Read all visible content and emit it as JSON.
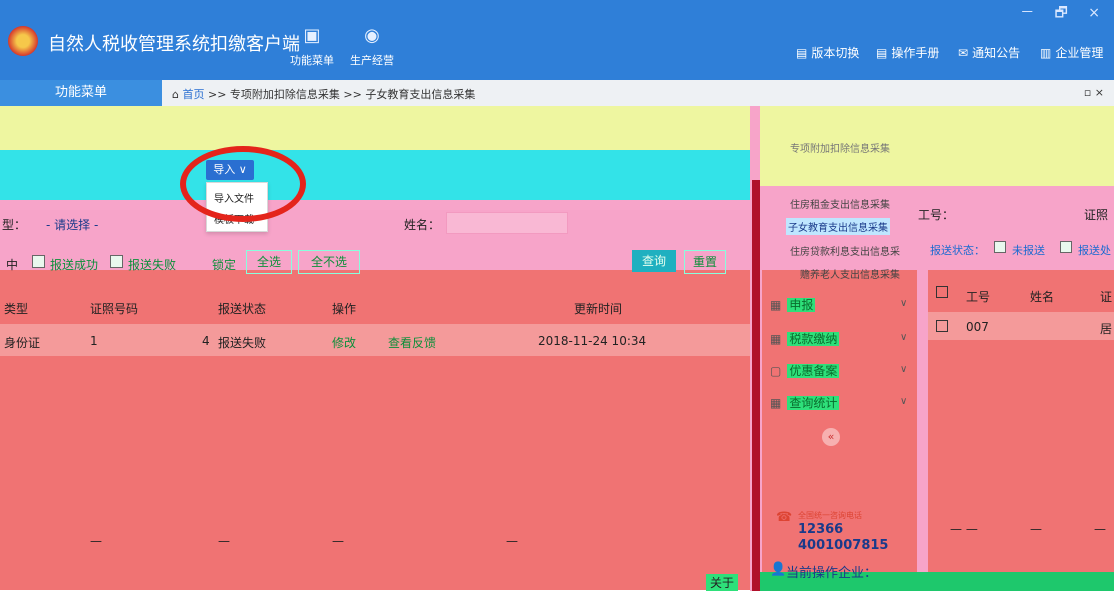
{
  "window": {
    "app_title": "自然人税收管理系统扣缴客户端",
    "controls": "－ 🗗 ×"
  },
  "top_nav": [
    {
      "label": "功能菜单",
      "icon": "wallet-icon"
    },
    {
      "label": "生产经营",
      "icon": "coins-icon"
    }
  ],
  "right_menu": [
    {
      "label": "版本切换",
      "icon": "document-icon"
    },
    {
      "label": "操作手册",
      "icon": "book-icon"
    },
    {
      "label": "通知公告",
      "icon": "mail-icon"
    },
    {
      "label": "企业管理",
      "icon": "building-icon"
    }
  ],
  "subbar": {
    "menu_tab": "功能菜单",
    "breadcrumb_home": "首页",
    "breadcrumb_rest": ">> 专项附加扣除信息采集 >> 子女教育支出信息采集",
    "tab_controls": "▫ ×"
  },
  "toolbar": {
    "import_label": "导入 ∨",
    "dropdown_items": [
      "导入文件",
      "模板下载"
    ]
  },
  "filters": {
    "type_label": "型：",
    "type_value": "- 请选择 -",
    "name_label": "姓名：",
    "status_in": "中",
    "status_success": "报送成功",
    "status_fail": "报送失败",
    "lock_label": "锁定",
    "select_all": "全选",
    "select_none": "全不选",
    "query": "查询",
    "reset": "重置"
  },
  "table": {
    "headers": [
      "类型",
      "证照号码",
      "报送状态",
      "操作",
      "更新时间"
    ],
    "rows": [
      {
        "type": "身份证",
        "id_start": "1",
        "id_end": "4",
        "status": "报送失败",
        "op1": "修改",
        "op2": "查看反馈",
        "updated": "2018-11-24 10:34"
      }
    ],
    "footer_dashes": [
      "—",
      "—",
      "—",
      "—"
    ]
  },
  "side_menu": {
    "sub_items": [
      "专项附加扣除信息采集",
      "住房租金支出信息采集",
      "子女教育支出信息采集",
      "住房贷款利息支出信息采",
      "赡养老人支出信息采集"
    ],
    "groups": [
      {
        "label": "申报",
        "icon": "grid-icon"
      },
      {
        "label": "税款缴纳",
        "icon": "grid-icon"
      },
      {
        "label": "优惠备案",
        "icon": "card-icon"
      },
      {
        "label": "查询统计",
        "icon": "grid-icon"
      }
    ],
    "collapse": "«",
    "hotline_title": "全国统一咨询电话",
    "hotline1": "12366",
    "hotline2": "4001007815",
    "current_company": "当前操作企业："
  },
  "right_panel": {
    "id_label": "工号：",
    "cert_label": "证照",
    "status_label": "报送状态：",
    "not_sent": "未报送",
    "sent": "报送处",
    "headers": [
      "工号",
      "姓名",
      "证"
    ],
    "row": {
      "id": "007",
      "cert": "居"
    },
    "footer": [
      "— —",
      "—",
      "—"
    ]
  },
  "misc": {
    "about": "关于"
  }
}
